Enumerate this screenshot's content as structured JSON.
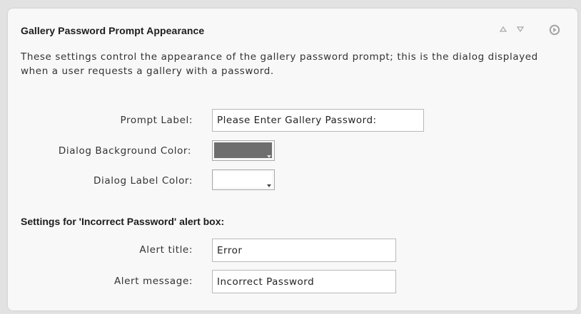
{
  "panel": {
    "title": "Gallery Password Prompt Appearance",
    "description": "These settings control the appearance of the gallery password prompt; this is the dialog displayed when a user requests a gallery with a password.",
    "icons": {
      "move_up": "triangle-up-icon",
      "move_down": "triangle-down-icon",
      "collapse": "circle-arrow-icon"
    }
  },
  "prompt_label": {
    "label": "Prompt Label:",
    "value": "Please Enter Gallery Password:"
  },
  "dialog_bg_color": {
    "label": "Dialog Background Color:",
    "color": "#6e6e6e"
  },
  "dialog_label_color": {
    "label": "Dialog Label Color:",
    "color": "#ffffff"
  },
  "alert_section": {
    "title": "Settings for 'Incorrect Password' alert box:"
  },
  "alert_title": {
    "label": "Alert title:",
    "value": "Error"
  },
  "alert_message": {
    "label": "Alert message:",
    "value": "Incorrect Password"
  }
}
